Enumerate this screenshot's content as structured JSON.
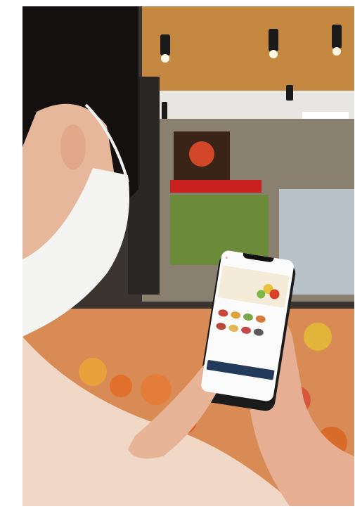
{
  "photo": {
    "description_colors": {
      "ceiling": "#c98b3f",
      "mask": "#f3f3f3",
      "sweater": "#f2d9c8",
      "shelf_red_sign": "#c8201e",
      "produce_orange": "#e88a3a"
    }
  },
  "phone": {
    "app_title": "",
    "banner_small": "",
    "banner_title": "",
    "toast": ""
  }
}
